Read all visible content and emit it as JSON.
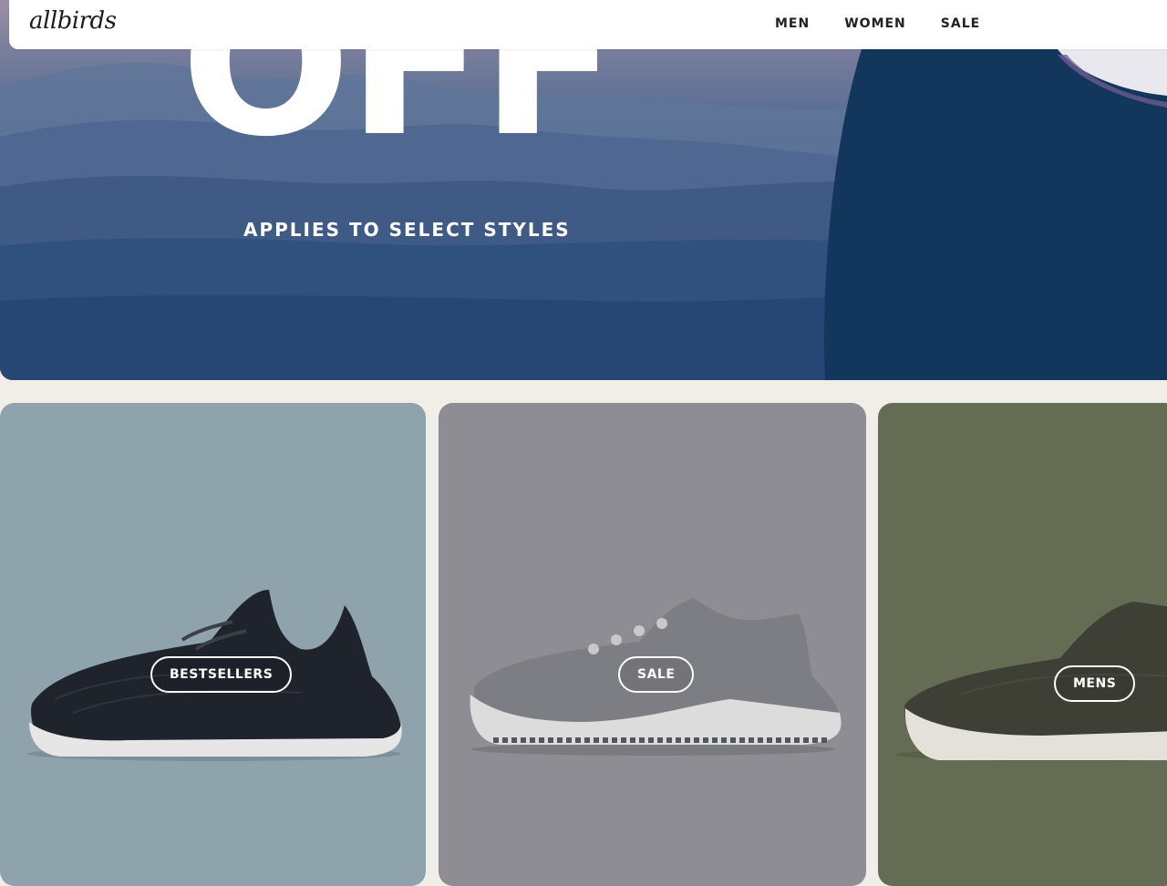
{
  "header": {
    "logo_text": "allbirds",
    "nav": [
      {
        "label": "MEN"
      },
      {
        "label": "WOMEN"
      },
      {
        "label": "SALE"
      }
    ]
  },
  "hero": {
    "headline": "OFF",
    "subtitle": "APPLIES TO SELECT STYLES"
  },
  "cards": [
    {
      "label": "BESTSELLERS",
      "bg_color": "#8fa3ad",
      "shoe_color": "#1f232c"
    },
    {
      "label": "SALE",
      "bg_color": "#8d8d93",
      "shoe_color": "#7d7e84"
    },
    {
      "label": "MENS",
      "bg_color": "#646c54",
      "shoe_color": "#3e3f35"
    }
  ]
}
